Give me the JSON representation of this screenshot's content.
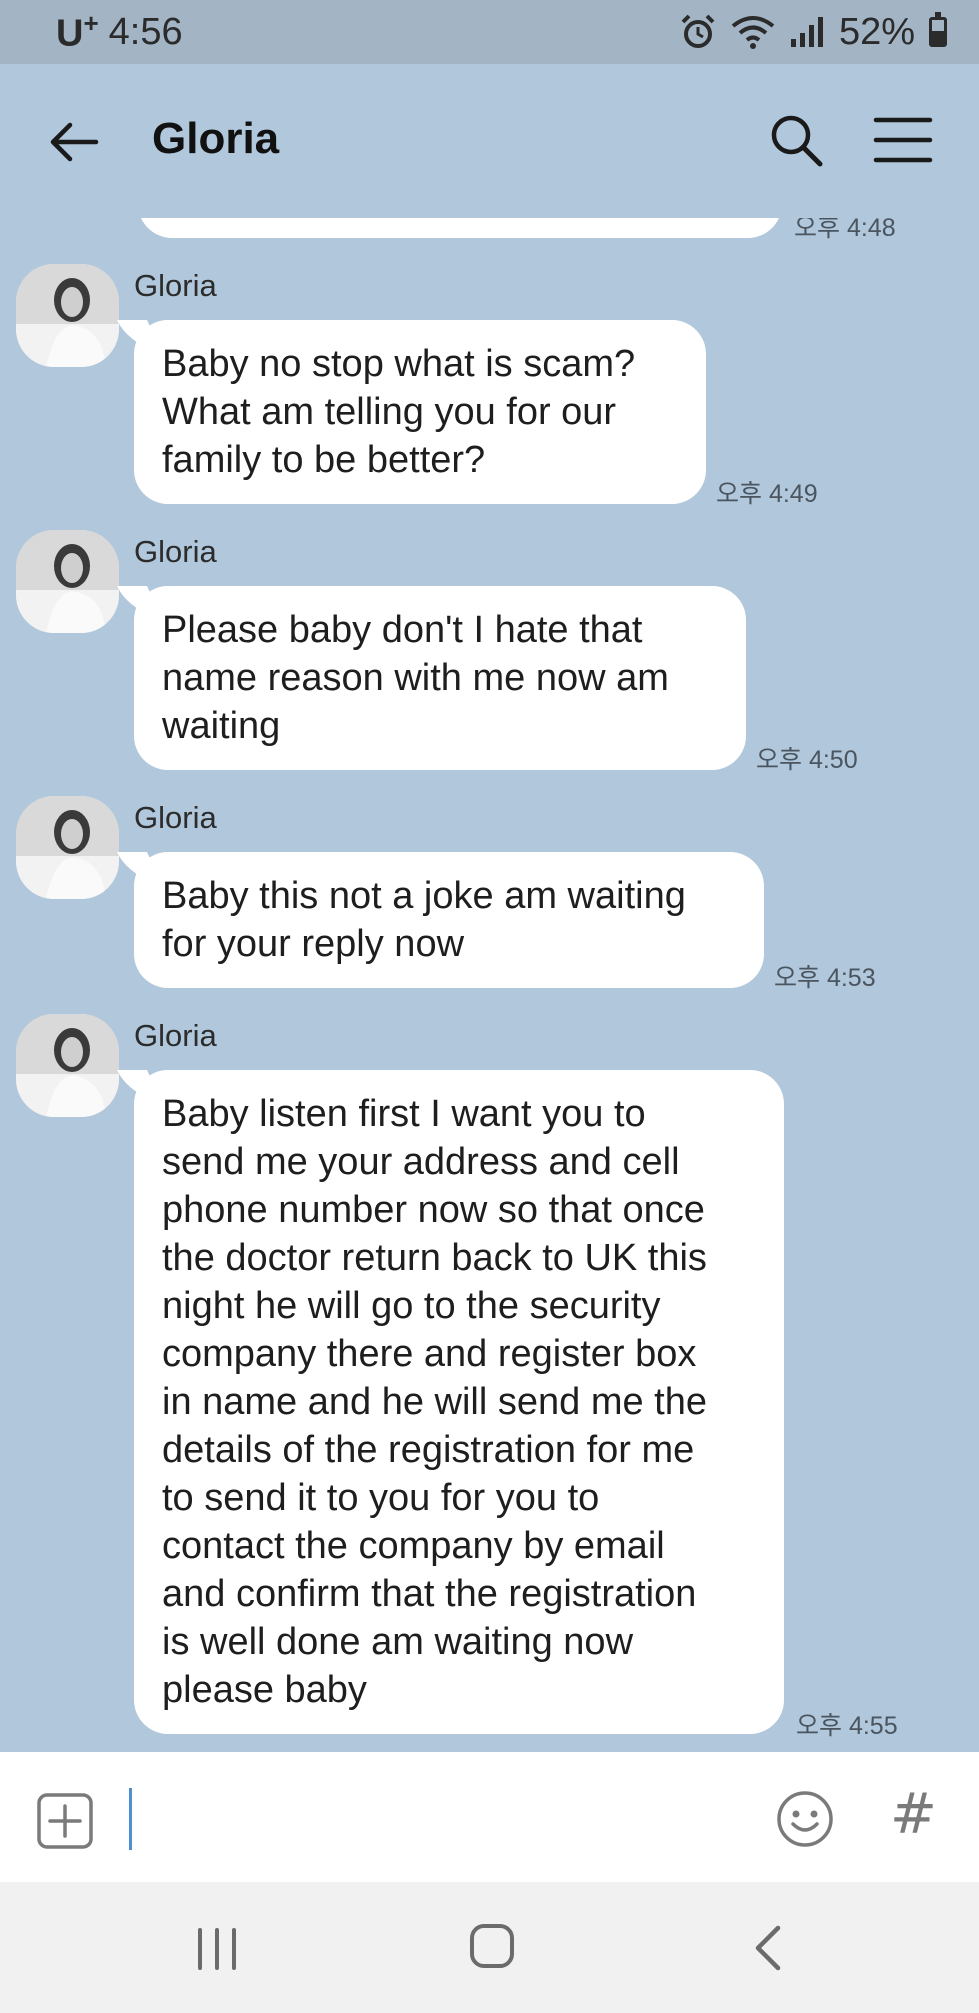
{
  "status_bar": {
    "carrier": "U",
    "carrier_plus": "+",
    "time": "4:56",
    "battery": "52%",
    "icons": [
      "alarm-icon",
      "wifi-icon",
      "signal-icon",
      "battery-icon"
    ]
  },
  "header": {
    "title": "Gloria",
    "icons": [
      "back-arrow-icon",
      "search-icon",
      "menu-icon"
    ]
  },
  "chat": {
    "partial_time": "오후 4:48",
    "messages": [
      {
        "sender": "Gloria",
        "lines": [
          "Baby no stop what is scam?",
          "What am telling you for our",
          "family to be better?"
        ],
        "time": "오후 4:49"
      },
      {
        "sender": "Gloria",
        "lines": [
          "Please baby don't I hate that",
          "name reason with me now am",
          "waiting"
        ],
        "time": "오후 4:50"
      },
      {
        "sender": "Gloria",
        "lines": [
          "Baby this not a joke am waiting",
          "for your reply now"
        ],
        "time": "오후 4:53"
      },
      {
        "sender": "Gloria",
        "lines": [
          "Baby listen first I want you to",
          "send me your address and cell",
          "phone number now so that once",
          "the doctor return back to UK this",
          "night he will go to the security",
          "company there and register box",
          "in name and he will send me the",
          "details of the registration for me",
          "to send it to you for you to",
          "contact the company by email",
          "and confirm that the registration",
          "is well done am waiting now",
          "please baby"
        ],
        "time": "오후 4:55"
      }
    ]
  },
  "input_bar": {
    "value": "",
    "hashtag": "#",
    "icons": [
      "plus-icon",
      "emoji-icon",
      "hashtag-icon"
    ]
  },
  "nav_bar": {
    "icons": [
      "recent-apps-icon",
      "home-icon",
      "back-icon"
    ]
  },
  "colors": {
    "chat_background": "#b0c7dc",
    "status_bar": "#a3b4c5",
    "bubble": "#ffffff",
    "cursor": "#4e8fd0"
  }
}
